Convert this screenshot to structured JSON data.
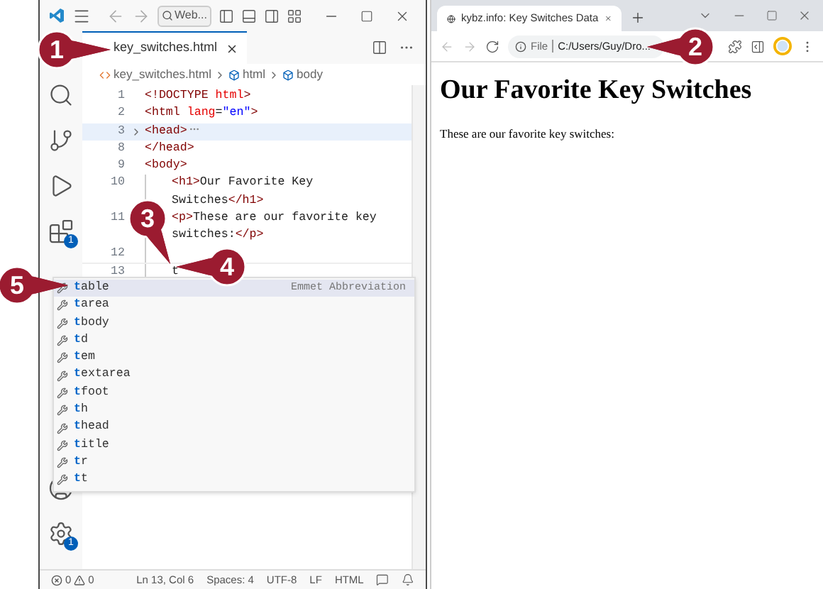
{
  "vscode": {
    "command_center": "Web...",
    "tabs": [
      {
        "label": "key_switches.html",
        "selected": true
      }
    ],
    "breadcrumbs": [
      {
        "label": "key_switches.html",
        "kind": "file"
      },
      {
        "label": "html",
        "kind": "symbol"
      },
      {
        "label": "body",
        "kind": "symbol"
      }
    ],
    "activity_badges": {
      "extensions": "1",
      "settings": "1"
    },
    "code_lines": [
      {
        "number": "1",
        "indent": false,
        "folded": false,
        "current": false,
        "segments": [
          {
            "text": "<!DOCTYPE ",
            "kind": "tag"
          },
          {
            "text": "html",
            "kind": "attr"
          },
          {
            "text": ">",
            "kind": "tag"
          }
        ]
      },
      {
        "number": "2",
        "indent": false,
        "folded": false,
        "current": false,
        "segments": [
          {
            "text": "<html ",
            "kind": "tag"
          },
          {
            "text": "lang",
            "kind": "attr"
          },
          {
            "text": "=",
            "kind": "text"
          },
          {
            "text": "\"en\"",
            "kind": "string"
          },
          {
            "text": ">",
            "kind": "tag"
          }
        ]
      },
      {
        "number": "3",
        "indent": false,
        "folded": true,
        "current": false,
        "segments": [
          {
            "text": "<head>",
            "kind": "tag"
          }
        ]
      },
      {
        "number": "8",
        "indent": false,
        "folded": false,
        "current": false,
        "segments": [
          {
            "text": "</head>",
            "kind": "tag"
          }
        ]
      },
      {
        "number": "9",
        "indent": false,
        "folded": false,
        "current": false,
        "segments": [
          {
            "text": "<body>",
            "kind": "tag"
          }
        ]
      },
      {
        "number": "10",
        "indent": true,
        "folded": false,
        "current": false,
        "segments": [
          {
            "text": "<h1>",
            "kind": "tag"
          },
          {
            "text": "Our Favorite Key Switches",
            "kind": "text"
          },
          {
            "text": "</h1>",
            "kind": "tag"
          }
        ]
      },
      {
        "number": "11",
        "indent": true,
        "folded": false,
        "current": false,
        "segments": [
          {
            "text": "<p>",
            "kind": "tag"
          },
          {
            "text": "These are our favorite key switches:",
            "kind": "text"
          },
          {
            "text": "</p>",
            "kind": "tag"
          }
        ]
      },
      {
        "number": "12",
        "indent": true,
        "folded": false,
        "current": false
      },
      {
        "number": "13",
        "indent": true,
        "folded": false,
        "current": true,
        "segments": [
          {
            "text": "t",
            "kind": "text"
          }
        ]
      }
    ],
    "suggestions": {
      "detail": "Emmet Abbreviation",
      "items": [
        {
          "match": "t",
          "rest": "able",
          "selected": true
        },
        {
          "match": "t",
          "rest": "area",
          "selected": false
        },
        {
          "match": "t",
          "rest": "body",
          "selected": false
        },
        {
          "match": "t",
          "rest": "d",
          "selected": false
        },
        {
          "match": "t",
          "rest": "em",
          "selected": false
        },
        {
          "match": "t",
          "rest": "extarea",
          "selected": false
        },
        {
          "match": "t",
          "rest": "foot",
          "selected": false
        },
        {
          "match": "t",
          "rest": "h",
          "selected": false
        },
        {
          "match": "t",
          "rest": "head",
          "selected": false
        },
        {
          "match": "t",
          "rest": "itle",
          "selected": false
        },
        {
          "match": "t",
          "rest": "r",
          "selected": false
        },
        {
          "match": "t",
          "rest": "t",
          "selected": false
        }
      ]
    },
    "status_bar": {
      "errors": "0",
      "warnings": "0",
      "items": [
        "Ln 13, Col 6",
        "Spaces: 4",
        "UTF-8",
        "LF",
        "HTML"
      ]
    }
  },
  "browser": {
    "tab_title": "kybz.info: Key Switches Data",
    "address_label": "File",
    "address": "C:/Users/Guy/Dro...",
    "heading": "Our Favorite Key Switches",
    "paragraph": "These are our favorite key switches:"
  },
  "callouts": [
    {
      "label": "1"
    },
    {
      "label": "2"
    },
    {
      "label": "3"
    },
    {
      "label": "4"
    },
    {
      "label": "5"
    }
  ]
}
